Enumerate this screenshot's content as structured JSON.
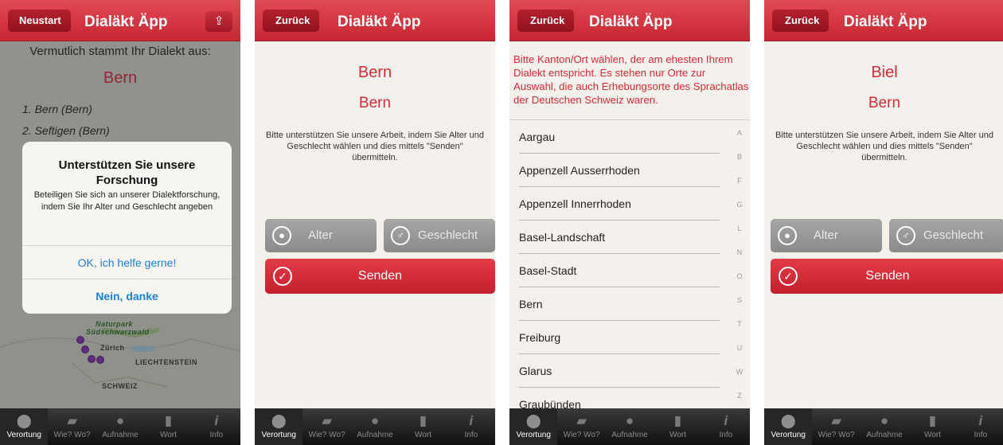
{
  "app_title": "Dialäkt Äpp",
  "tabs": [
    "Verortung",
    "Wie? Wo?",
    "Aufnahme",
    "Wort",
    "Info"
  ],
  "s1": {
    "restart_label": "Neustart",
    "intro": "Vermutlich stammt Ihr Dialekt aus:",
    "result": "Bern",
    "list": [
      "1. Bern (Bern)",
      "2. Seftigen (Bern)"
    ],
    "map_labels": {
      "naturpark": "Naturpark",
      "suedschwarzwald": "Südschwarzwald",
      "zurich": "Zürich",
      "liechtenstein": "LIECHTENSTEIN",
      "schweiz": "SCHWEIZ"
    },
    "alert": {
      "title": "Unterstützen Sie unsere Forschung",
      "message": "Beteiligen Sie sich an unserer Dialektforschung, indem Sie Ihr Alter und Geschlecht angeben",
      "ok": "OK, ich helfe gerne!",
      "cancel": "Nein, danke"
    }
  },
  "back_label": "Zurück",
  "support_text": "Bitte unterstützen Sie unsere Arbeit, indem Sie Alter und Geschlecht wählen und dies mittels \"Senden\" übermitteln.",
  "age_label": "Alter",
  "gender_label": "Geschlecht",
  "send_label": "Senden",
  "s2": {
    "line1": "Bern",
    "line2": "Bern"
  },
  "s3": {
    "info": "Bitte Kanton/Ort wählen, der am ehesten Ihrem Dialekt entspricht. Es stehen nur Orte zur Auswahl, die auch Erhebungsorte des Sprachatlas der Deutschen Schweiz waren.",
    "cantons": [
      "Aargau",
      "Appenzell Ausserrhoden",
      "Appenzell Innerrhoden",
      "Basel-Landschaft",
      "Basel-Stadt",
      "Bern",
      "Freiburg",
      "Glarus",
      "Graubünden"
    ],
    "index": [
      "A",
      "B",
      "F",
      "G",
      "L",
      "N",
      "O",
      "S",
      "T",
      "U",
      "W",
      "Z"
    ]
  },
  "s4": {
    "line1": "Biel",
    "line2": "Bern"
  }
}
